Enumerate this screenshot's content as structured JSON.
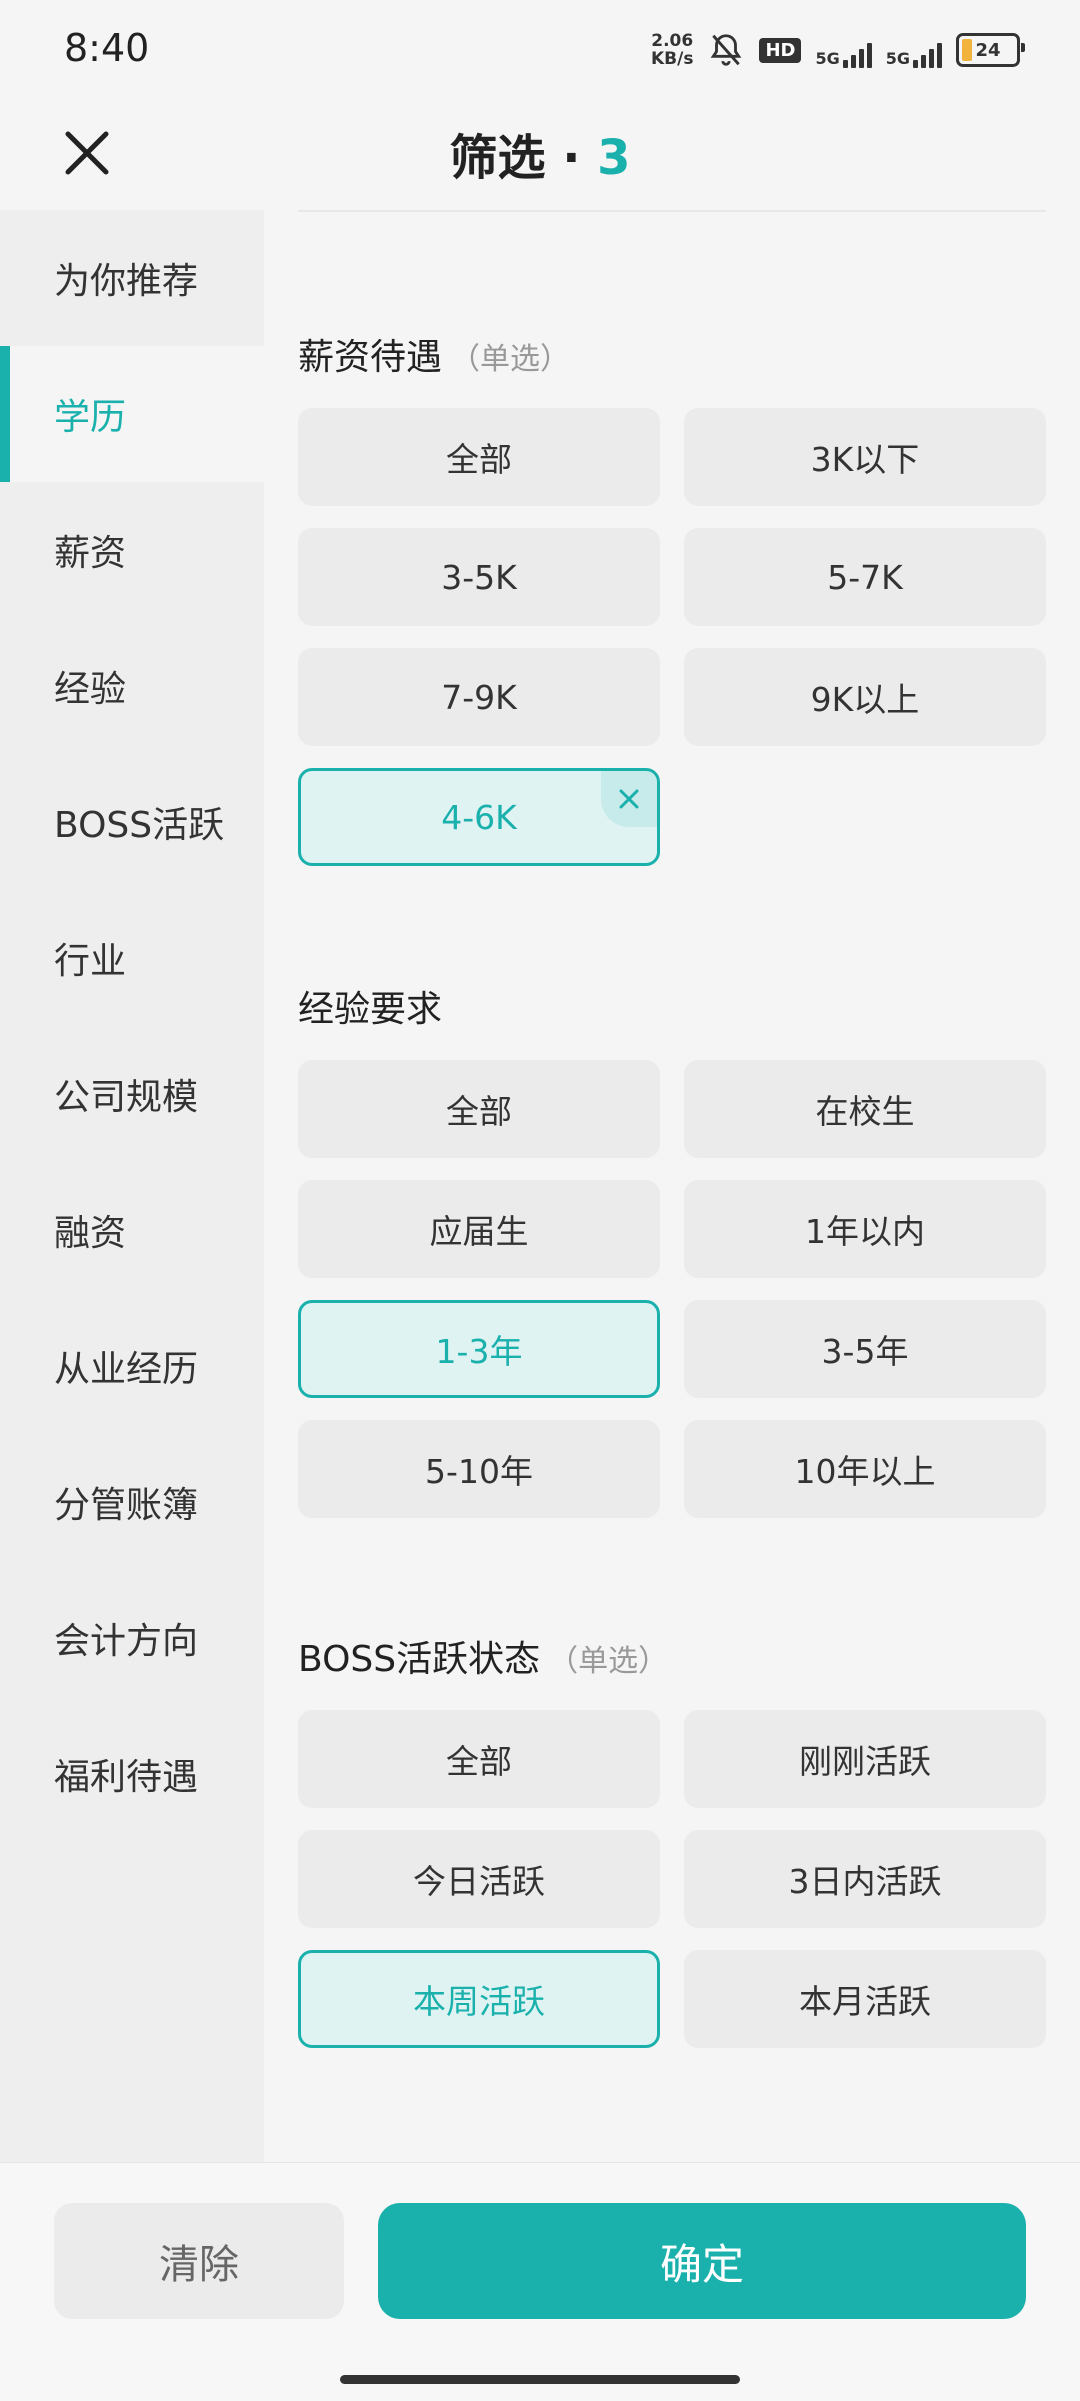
{
  "status_bar": {
    "time": "8:40",
    "speed_value": "2.06",
    "speed_unit": "KB/s",
    "hd": "HD",
    "net1": "5G",
    "net2": "5G",
    "battery": "24",
    "battery_color": "#f2b33d"
  },
  "header": {
    "title": "筛选",
    "separator": "·",
    "count": "3",
    "close_icon": "close-icon"
  },
  "sidebar": {
    "items": [
      {
        "label": "为你推荐"
      },
      {
        "label": "学历"
      },
      {
        "label": "薪资"
      },
      {
        "label": "经验"
      },
      {
        "label": "BOSS活跃"
      },
      {
        "label": "行业"
      },
      {
        "label": "公司规模"
      },
      {
        "label": "融资"
      },
      {
        "label": "从业经历"
      },
      {
        "label": "分管账簿"
      },
      {
        "label": "会计方向"
      },
      {
        "label": "福利待遇"
      }
    ],
    "active_index": 1
  },
  "sections": {
    "salary": {
      "title": "薪资待遇",
      "hint": "（单选）",
      "options": [
        "全部",
        "3K以下",
        "3-5K",
        "5-7K",
        "7-9K",
        "9K以上",
        "4-6K"
      ],
      "selected": "4-6K"
    },
    "experience": {
      "title": "经验要求",
      "options": [
        "全部",
        "在校生",
        "应届生",
        "1年以内",
        "1-3年",
        "3-5年",
        "5-10年",
        "10年以上"
      ],
      "selected": "1-3年"
    },
    "boss": {
      "title": "BOSS活跃状态",
      "hint": "（单选）",
      "options": [
        "全部",
        "刚刚活跃",
        "今日活跃",
        "3日内活跃",
        "本周活跃",
        "本月活跃"
      ],
      "selected": "本周活跃"
    }
  },
  "footer": {
    "clear_label": "清除",
    "confirm_label": "确定"
  },
  "colors": {
    "accent": "#1ab1ad",
    "selected_bg": "#e0f3f3"
  }
}
